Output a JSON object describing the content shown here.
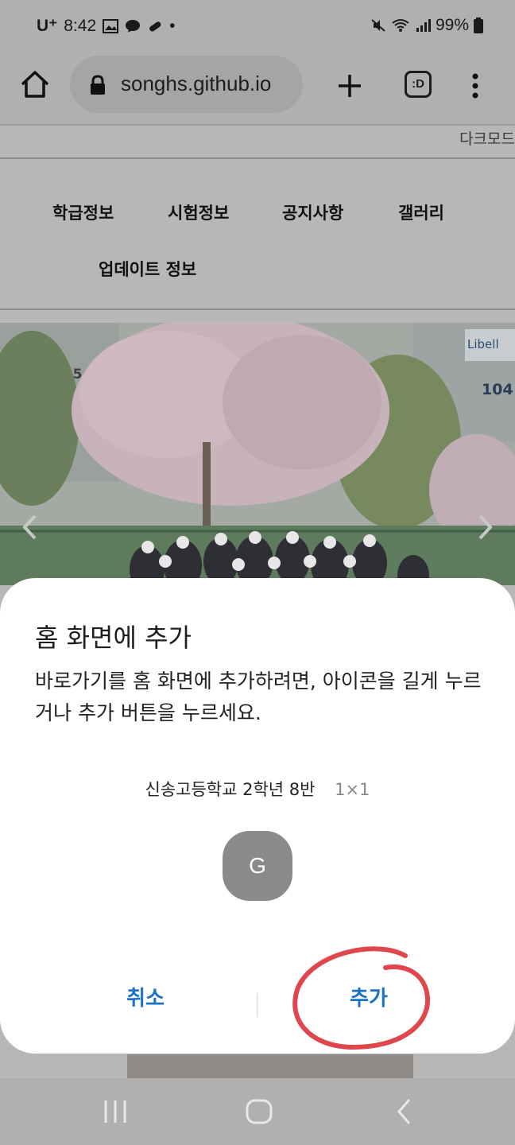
{
  "status": {
    "carrier": "U⁺",
    "time": "8:42",
    "dot": "•",
    "battery": "99%"
  },
  "browser": {
    "url": "songhs.github.io",
    "tabs_label": ":D"
  },
  "page": {
    "dark_mode": "다크모드",
    "nav": {
      "class_info": "학급정보",
      "exam_info": "시험정보",
      "notice": "공지사항",
      "gallery": "갤러리",
      "update_info": "업데이트 정보"
    },
    "photo_signs": {
      "left_building": "105",
      "right_building": "104",
      "store": "Libell"
    }
  },
  "dialog": {
    "title": "홈 화면에 추가",
    "message": "바로가기를 홈 화면에 추가하려면, 아이콘을 길게 누르거나 추가 버튼을 누르세요.",
    "item_name": "신송고등학교 2학년 8반",
    "item_size": "1×1",
    "icon_letter": "G",
    "cancel_label": "취소",
    "add_label": "추가"
  },
  "colors": {
    "accent": "#1a73c5",
    "annotation": "#e0474c"
  }
}
